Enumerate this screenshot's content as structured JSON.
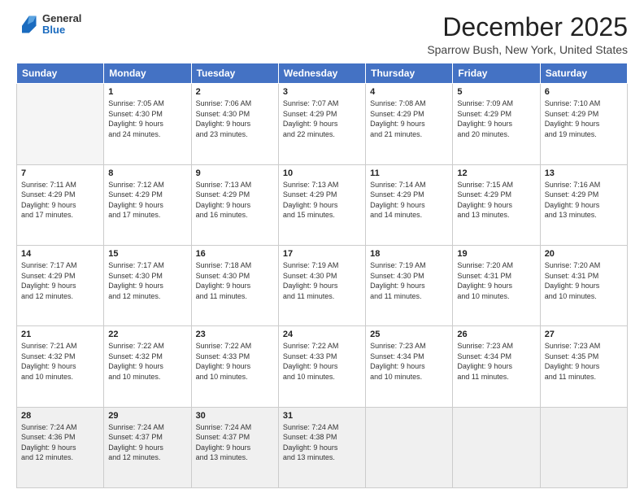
{
  "header": {
    "logo": {
      "general": "General",
      "blue": "Blue"
    },
    "title": "December 2025",
    "subtitle": "Sparrow Bush, New York, United States"
  },
  "calendar": {
    "days": [
      "Sunday",
      "Monday",
      "Tuesday",
      "Wednesday",
      "Thursday",
      "Friday",
      "Saturday"
    ],
    "weeks": [
      [
        {
          "day": "",
          "info": ""
        },
        {
          "day": "1",
          "info": "Sunrise: 7:05 AM\nSunset: 4:30 PM\nDaylight: 9 hours\nand 24 minutes."
        },
        {
          "day": "2",
          "info": "Sunrise: 7:06 AM\nSunset: 4:30 PM\nDaylight: 9 hours\nand 23 minutes."
        },
        {
          "day": "3",
          "info": "Sunrise: 7:07 AM\nSunset: 4:29 PM\nDaylight: 9 hours\nand 22 minutes."
        },
        {
          "day": "4",
          "info": "Sunrise: 7:08 AM\nSunset: 4:29 PM\nDaylight: 9 hours\nand 21 minutes."
        },
        {
          "day": "5",
          "info": "Sunrise: 7:09 AM\nSunset: 4:29 PM\nDaylight: 9 hours\nand 20 minutes."
        },
        {
          "day": "6",
          "info": "Sunrise: 7:10 AM\nSunset: 4:29 PM\nDaylight: 9 hours\nand 19 minutes."
        }
      ],
      [
        {
          "day": "7",
          "info": "Sunrise: 7:11 AM\nSunset: 4:29 PM\nDaylight: 9 hours\nand 17 minutes."
        },
        {
          "day": "8",
          "info": "Sunrise: 7:12 AM\nSunset: 4:29 PM\nDaylight: 9 hours\nand 17 minutes."
        },
        {
          "day": "9",
          "info": "Sunrise: 7:13 AM\nSunset: 4:29 PM\nDaylight: 9 hours\nand 16 minutes."
        },
        {
          "day": "10",
          "info": "Sunrise: 7:13 AM\nSunset: 4:29 PM\nDaylight: 9 hours\nand 15 minutes."
        },
        {
          "day": "11",
          "info": "Sunrise: 7:14 AM\nSunset: 4:29 PM\nDaylight: 9 hours\nand 14 minutes."
        },
        {
          "day": "12",
          "info": "Sunrise: 7:15 AM\nSunset: 4:29 PM\nDaylight: 9 hours\nand 13 minutes."
        },
        {
          "day": "13",
          "info": "Sunrise: 7:16 AM\nSunset: 4:29 PM\nDaylight: 9 hours\nand 13 minutes."
        }
      ],
      [
        {
          "day": "14",
          "info": "Sunrise: 7:17 AM\nSunset: 4:29 PM\nDaylight: 9 hours\nand 12 minutes."
        },
        {
          "day": "15",
          "info": "Sunrise: 7:17 AM\nSunset: 4:30 PM\nDaylight: 9 hours\nand 12 minutes."
        },
        {
          "day": "16",
          "info": "Sunrise: 7:18 AM\nSunset: 4:30 PM\nDaylight: 9 hours\nand 11 minutes."
        },
        {
          "day": "17",
          "info": "Sunrise: 7:19 AM\nSunset: 4:30 PM\nDaylight: 9 hours\nand 11 minutes."
        },
        {
          "day": "18",
          "info": "Sunrise: 7:19 AM\nSunset: 4:30 PM\nDaylight: 9 hours\nand 11 minutes."
        },
        {
          "day": "19",
          "info": "Sunrise: 7:20 AM\nSunset: 4:31 PM\nDaylight: 9 hours\nand 10 minutes."
        },
        {
          "day": "20",
          "info": "Sunrise: 7:20 AM\nSunset: 4:31 PM\nDaylight: 9 hours\nand 10 minutes."
        }
      ],
      [
        {
          "day": "21",
          "info": "Sunrise: 7:21 AM\nSunset: 4:32 PM\nDaylight: 9 hours\nand 10 minutes."
        },
        {
          "day": "22",
          "info": "Sunrise: 7:22 AM\nSunset: 4:32 PM\nDaylight: 9 hours\nand 10 minutes."
        },
        {
          "day": "23",
          "info": "Sunrise: 7:22 AM\nSunset: 4:33 PM\nDaylight: 9 hours\nand 10 minutes."
        },
        {
          "day": "24",
          "info": "Sunrise: 7:22 AM\nSunset: 4:33 PM\nDaylight: 9 hours\nand 10 minutes."
        },
        {
          "day": "25",
          "info": "Sunrise: 7:23 AM\nSunset: 4:34 PM\nDaylight: 9 hours\nand 10 minutes."
        },
        {
          "day": "26",
          "info": "Sunrise: 7:23 AM\nSunset: 4:34 PM\nDaylight: 9 hours\nand 11 minutes."
        },
        {
          "day": "27",
          "info": "Sunrise: 7:23 AM\nSunset: 4:35 PM\nDaylight: 9 hours\nand 11 minutes."
        }
      ],
      [
        {
          "day": "28",
          "info": "Sunrise: 7:24 AM\nSunset: 4:36 PM\nDaylight: 9 hours\nand 12 minutes."
        },
        {
          "day": "29",
          "info": "Sunrise: 7:24 AM\nSunset: 4:37 PM\nDaylight: 9 hours\nand 12 minutes."
        },
        {
          "day": "30",
          "info": "Sunrise: 7:24 AM\nSunset: 4:37 PM\nDaylight: 9 hours\nand 13 minutes."
        },
        {
          "day": "31",
          "info": "Sunrise: 7:24 AM\nSunset: 4:38 PM\nDaylight: 9 hours\nand 13 minutes."
        },
        {
          "day": "",
          "info": ""
        },
        {
          "day": "",
          "info": ""
        },
        {
          "day": "",
          "info": ""
        }
      ]
    ]
  }
}
